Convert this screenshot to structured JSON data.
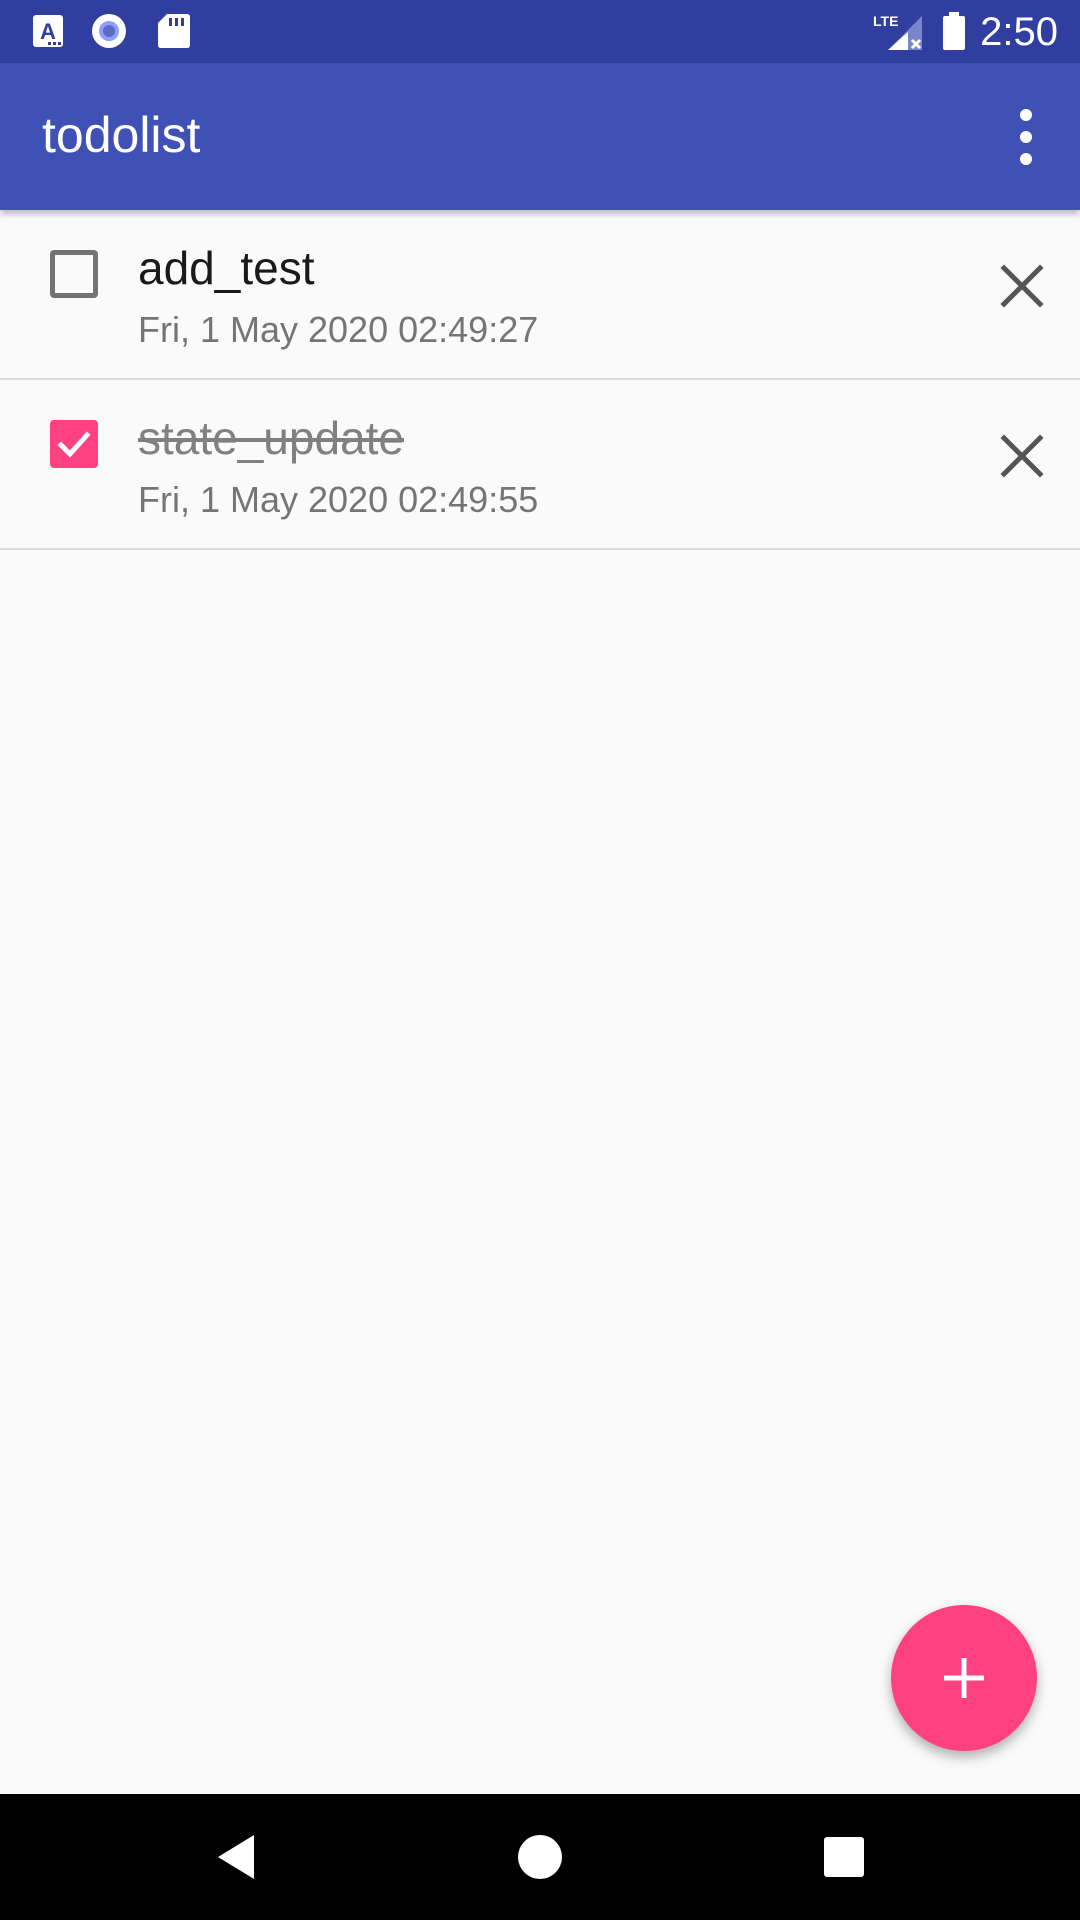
{
  "status_bar": {
    "time": "2:50",
    "network_label": "LTE",
    "icons": [
      "font-a-icon",
      "circle-record-icon",
      "sd-card-icon",
      "signal-icon",
      "battery-icon"
    ]
  },
  "app_bar": {
    "title": "todolist",
    "overflow_icon": "more-vert-icon",
    "background": "#3f51b5",
    "status_background": "#303f9f"
  },
  "todos": [
    {
      "title": "add_test",
      "date": "Fri, 1 May 2020 02:49:27",
      "done": false
    },
    {
      "title": "state_update",
      "date": "Fri, 1 May 2020 02:49:55",
      "done": true
    }
  ],
  "fab": {
    "icon": "plus-icon",
    "color": "#ff4081"
  },
  "nav_bar": {
    "icons": [
      "back-icon",
      "home-icon",
      "recents-icon"
    ]
  }
}
